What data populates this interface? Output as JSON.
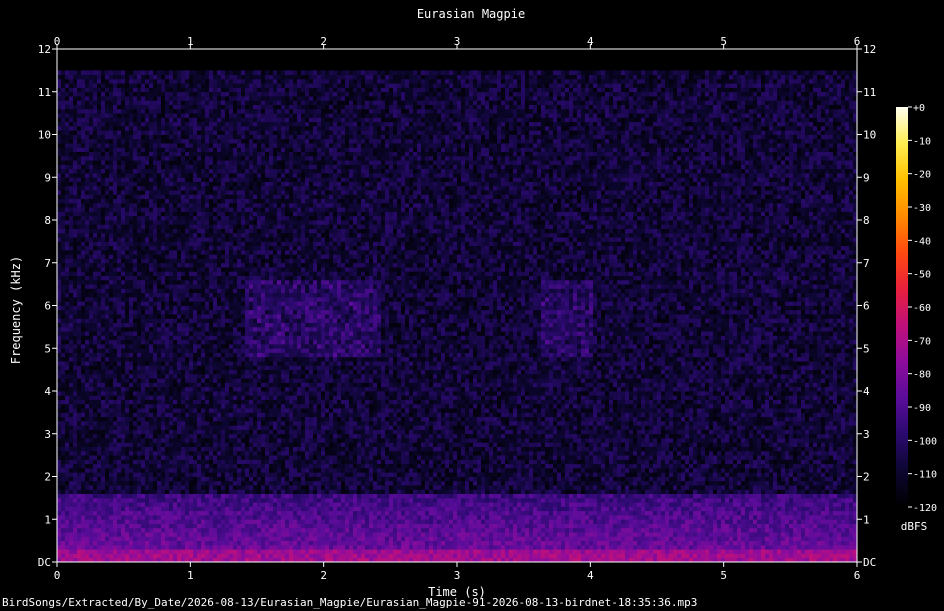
{
  "chart_data": {
    "type": "heatmap",
    "title": "Eurasian Magpie",
    "xlabel": "Time (s)",
    "ylabel": "Frequency (kHz)",
    "x_ticks": [
      "0",
      "1",
      "2",
      "3",
      "4",
      "5",
      "6"
    ],
    "y_ticks": [
      "DC",
      "1",
      "2",
      "3",
      "4",
      "5",
      "6",
      "7",
      "8",
      "9",
      "10",
      "11",
      "12"
    ],
    "xlim": [
      0,
      6
    ],
    "ylim": [
      0,
      12
    ],
    "content_max_khz": 11.5,
    "colorbar": {
      "label": "dBFS",
      "ticks": [
        "+0",
        "-10",
        "-20",
        "-30",
        "-40",
        "-50",
        "-60",
        "-70",
        "-80",
        "-90",
        "-100",
        "-110",
        "-120"
      ],
      "range": [
        -120,
        0
      ],
      "colors": [
        "#000000",
        "#0c0630",
        "#2a0a6e",
        "#5a0c9a",
        "#8e0c9c",
        "#c0107a",
        "#e8203c",
        "#ff4a10",
        "#ff8a00",
        "#ffc000",
        "#ffee50",
        "#fffff0"
      ]
    },
    "notes": {
      "low_band_khz": [
        0,
        1.6
      ],
      "low_band_level_dbfs": -82,
      "background_level_dbfs": -108,
      "activity_segments_s": [
        [
          1.4,
          2.4
        ],
        [
          3.6,
          4.0
        ]
      ],
      "activity_freq_khz": [
        4.8,
        6.5
      ]
    }
  },
  "filename": "BirdSongs/Extracted/By_Date/2026-08-13/Eurasian_Magpie/Eurasian_Magpie-91-2026-08-13-birdnet-18:35:36.mp3"
}
